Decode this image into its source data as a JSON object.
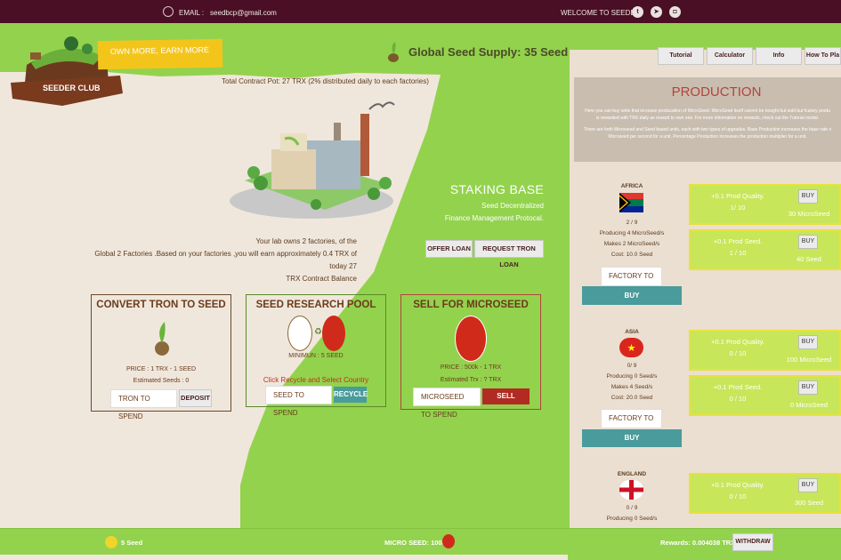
{
  "topbar": {
    "email_label": "EMAIL :",
    "email_value": "seedbcp@gmail.com",
    "welcome": "WELCOME TO SEEDBC",
    "social": [
      "twitter-icon",
      "telegram-icon",
      "discord-icon"
    ]
  },
  "logo": {
    "text": "SEEDER CLUB"
  },
  "banner": {
    "text": "OWN MORE, EARN MORE"
  },
  "supply": {
    "text": "Global Seed Supply: 35 Seed"
  },
  "contract_pot": "Total Contract Pot: 27 TRX (2% distributed daily to each factories)",
  "lab": {
    "line1": "Your lab owns 2 factories, of the",
    "line2": "Global 2 Factories .Based on your factories ,you will earn approximately 0.4 TRX of today 27",
    "line3": "TRX Contract Balance"
  },
  "staking": {
    "title": "STAKING BASE",
    "line1": "Seed Decentralized",
    "line2": "Finance Management Protocal.",
    "offer_loan": "OFFER LOAN",
    "request_loan": "REQUEST TRON LOAN"
  },
  "convert": {
    "title": "CONVERT TRON TO SEED",
    "price": "PRICE : 1 TRX - 1 SEED",
    "estimated": "Estimated Seeds : 0",
    "placeholder": "TRON TO SPEND",
    "button": "DEPOSIT"
  },
  "research": {
    "title": "SEED RESEARCH POOL",
    "minimum": "MINIMUN : 5 SEED",
    "note": "Click Recycle and Select Country",
    "placeholder": "SEED TO SPEND",
    "button": "RECYCLE"
  },
  "sell": {
    "title": "SELL FOR MICROSEED",
    "price": "PRICE : 500k - 1 TRX",
    "estimated": "Estimated Trx : ? TRX",
    "placeholder": "MICROSEED TO SPEND",
    "button": "SELL"
  },
  "tabs": [
    "Tutorial",
    "Calculator",
    "Info",
    "How To Pla"
  ],
  "production": {
    "title": "PRODUCTION",
    "desc1": "Here you can buy units that increase producation of MicroSeed. MicroSeed itself cannot be bought but sold but fcatory produ",
    "desc2": "is rewarded with TRX daily as reward to own one. For more information on rewards, check out the Tutorial modal.",
    "desc3": "There are both Microseed and Seed based units, each with two types of upgrades. Base Production increases the base rate o",
    "desc4": "Microseed per second for a unit. Percentage Production increases the production multiplier for a unit."
  },
  "countries": [
    {
      "name": "AFRICA",
      "count": "2 / 9",
      "producing": "Producing 4 MicroSeed/s",
      "makes": "Makes 2 MicroSeed/s",
      "cost": "Cost: 10.0 Seed",
      "placeholder": "FACTORY TO BUY",
      "buy": "BUY",
      "upgrades": [
        {
          "label": "+0.1 Prod Quality.",
          "progress": "1/ 10",
          "buy": "BUY",
          "cost": "30 MicroSeed"
        },
        {
          "label": "+0.1 Prod Seed.",
          "progress": "1 / 10",
          "buy": "BUY",
          "cost": "40 Seed"
        }
      ]
    },
    {
      "name": "ASIA",
      "count": "0/ 9",
      "producing": "Producing 0 Seed/s",
      "makes": "Makes 4 Seed/s",
      "cost": "Cost: 20.0 Seed",
      "placeholder": "FACTORY TO BUY",
      "buy": "BUY",
      "upgrades": [
        {
          "label": "+0.1 Prod Quality.",
          "progress": "0 / 10",
          "buy": "BUY",
          "cost": "100 MicroSeed"
        },
        {
          "label": "+0.1 Prod Seed.",
          "progress": "0 / 10",
          "buy": "BUY",
          "cost": "0 MicroSeed"
        }
      ]
    },
    {
      "name": "ENGLAND",
      "count": "0 / 9",
      "producing": "Producing 0 Seed/s",
      "upgrades": [
        {
          "label": "+0.1 Prod Quality.",
          "progress": "0 / 10",
          "buy": "BUY",
          "cost": "300 Seed"
        }
      ]
    }
  ],
  "bottom": {
    "seed": "5 Seed",
    "micro": "MICRO SEED: 1008",
    "rewards": "Rewards: 0.004038 TRX",
    "withdraw": "WITHDRAW"
  }
}
